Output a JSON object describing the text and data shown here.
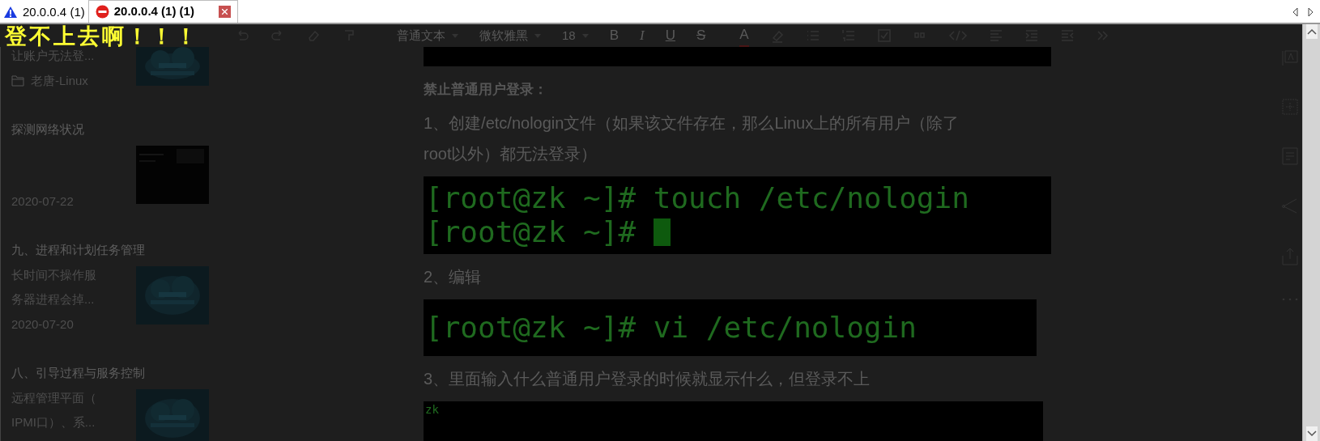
{
  "tabs": [
    {
      "label": "20.0.0.4 (1)",
      "kind": "warning",
      "selected": false
    },
    {
      "label": "20.0.0.4 (1) (1)",
      "kind": "error",
      "selected": true
    }
  ],
  "terminal_message": "登不上去啊！！！",
  "toolbar": {
    "style_select": "普通文本",
    "font_select": "微软雅黑",
    "size_select": "18",
    "bold": "B",
    "italic": "I",
    "underline": "U",
    "strike": "S",
    "font_color_letter": "A"
  },
  "articles": [
    {
      "summary": [
        "让账户无法登..."
      ],
      "folder": "老唐-Linux"
    },
    {
      "title": "探测网络状况",
      "date": "2020-07-22"
    },
    {
      "title": "九、进程和计划任务管理",
      "summary": [
        "长时间不操作服",
        "务器进程会掉..."
      ],
      "date": "2020-07-20"
    },
    {
      "title": "八、引导过程与服务控制",
      "summary": [
        "远程管理平面（",
        "IPMI口）、系..."
      ]
    }
  ],
  "content": [
    {
      "kind": "black_bar"
    },
    {
      "kind": "heading",
      "text": "禁止普通用户登录："
    },
    {
      "kind": "paragraph",
      "lines": [
        "1、创建/etc/nologin文件（如果该文件存在，那么Linux上的所有用户（除了",
        "root以外）都无法登录）"
      ]
    },
    {
      "kind": "terminal",
      "lines": [
        "[root@zk ~]# touch /etc/nologin",
        "[root@zk ~]# "
      ],
      "cursor": true
    },
    {
      "kind": "paragraph",
      "lines": [
        "2、编辑"
      ]
    },
    {
      "kind": "terminal",
      "lines": [
        "[root@zk ~]# vi /etc/nologin"
      ],
      "cursor": false
    },
    {
      "kind": "paragraph",
      "lines": [
        "3、里面输入什么普通用户登录的时候就显示什么，但登录不上"
      ]
    },
    {
      "kind": "console",
      "lines": [
        "zk"
      ]
    }
  ]
}
